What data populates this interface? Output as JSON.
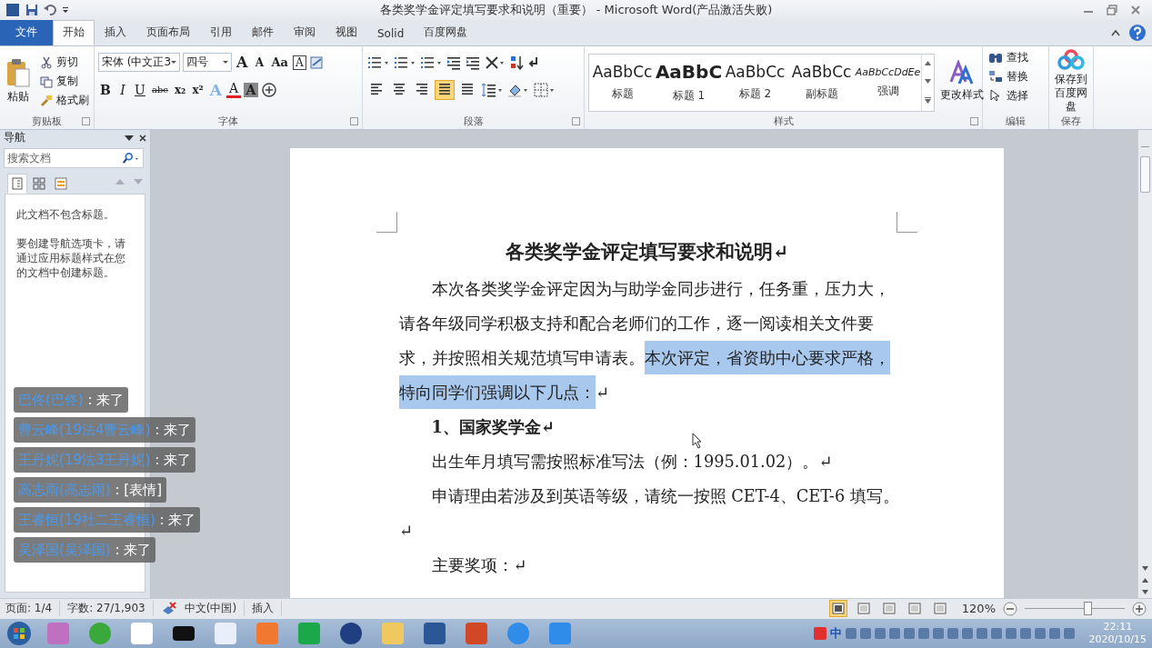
{
  "window": {
    "title": "各类奖学金评定填写要求和说明（重要） - Microsoft Word(产品激活失败)"
  },
  "ribbon_tabs": [
    {
      "label": "文件",
      "kind": "file",
      "selected": false
    },
    {
      "label": "开始",
      "kind": "tab",
      "selected": true
    },
    {
      "label": "插入",
      "kind": "tab",
      "selected": false
    },
    {
      "label": "页面布局",
      "kind": "tab",
      "selected": false
    },
    {
      "label": "引用",
      "kind": "tab",
      "selected": false
    },
    {
      "label": "邮件",
      "kind": "tab",
      "selected": false
    },
    {
      "label": "审阅",
      "kind": "tab",
      "selected": false
    },
    {
      "label": "视图",
      "kind": "tab",
      "selected": false
    },
    {
      "label": "Solid",
      "kind": "tab",
      "selected": false
    },
    {
      "label": "百度网盘",
      "kind": "tab",
      "selected": false
    }
  ],
  "clipboard": {
    "paste": "粘贴",
    "items": [
      {
        "label": "剪切",
        "kind": "cut"
      },
      {
        "label": "复制",
        "kind": "copy"
      },
      {
        "label": "格式刷",
        "kind": "brush"
      }
    ],
    "group": "剪贴板"
  },
  "font": {
    "name": "宋体 (中文正3",
    "size": "四号",
    "group": "字体",
    "row1": [
      {
        "label": "A",
        "kind": "grow"
      },
      {
        "label": "A",
        "kind": "shrink"
      },
      {
        "label": "Aa",
        "kind": "case"
      },
      {
        "label": "A",
        "kind": "border"
      }
    ],
    "row2": [
      {
        "label": "B",
        "kind": "bold"
      },
      {
        "label": "I",
        "kind": "italic"
      },
      {
        "label": "U",
        "kind": "underline"
      },
      {
        "label": "abc",
        "kind": "strike"
      },
      {
        "label": "x₂",
        "kind": "sub"
      },
      {
        "label": "x²",
        "kind": "sup"
      },
      {
        "label": "A",
        "kind": "effect"
      },
      {
        "label": "A",
        "kind": "color"
      },
      {
        "label": "A",
        "kind": "shade"
      }
    ]
  },
  "paragraph": {
    "group": "段落",
    "alignment": [
      {
        "kind": "left",
        "selected": false
      },
      {
        "kind": "center",
        "selected": false
      },
      {
        "kind": "right",
        "selected": false
      },
      {
        "kind": "justify",
        "selected": true
      },
      {
        "kind": "distributed",
        "selected": false
      }
    ]
  },
  "styles": {
    "group": "样式",
    "items": [
      {
        "preview": "AaBbCc",
        "label": "标题",
        "kind": "normal"
      },
      {
        "preview": "AaBbC",
        "label": "标题 1",
        "kind": "bold"
      },
      {
        "preview": "AaBbCc",
        "label": "标题 2",
        "kind": "normal"
      },
      {
        "preview": "AaBbCc",
        "label": "副标题",
        "kind": "normal"
      },
      {
        "preview": "AaBbCcDdEe",
        "label": "强调",
        "kind": "italic"
      }
    ],
    "change": "更改样式"
  },
  "editing": {
    "group": "编辑",
    "items": [
      {
        "label": "查找",
        "kind": "find"
      },
      {
        "label": "替换",
        "kind": "replace"
      },
      {
        "label": "选择",
        "kind": "select"
      }
    ]
  },
  "save": {
    "label": "保存到百度网盘",
    "group": "保存"
  },
  "navigation": {
    "title": "导航",
    "search_placeholder": "搜索文档",
    "tabs": [
      {
        "kind": "headings",
        "selected": true
      },
      {
        "kind": "pages",
        "selected": false
      },
      {
        "kind": "results",
        "selected": false
      }
    ],
    "messages": [
      "此文档不包含标题。",
      "要创建导航选项卡，请通过应用标题样式在您的文档中创建标题。"
    ]
  },
  "chat": [
    {
      "name": "巴佟(巴佟)",
      "message": ": 来了"
    },
    {
      "name": "曹云峰(19法4曹云峰)",
      "message": ": 来了"
    },
    {
      "name": "王丹妮(19法3王丹妮)",
      "message": ": 来了"
    },
    {
      "name": "高志雨(高志雨)",
      "message": ": [表情]"
    },
    {
      "name": "王睿恒(19社二王睿恒)",
      "message": ": 来了"
    },
    {
      "name": "吴泽国(吴泽国)",
      "message": ": 来了"
    }
  ],
  "document": {
    "title": "各类奖学金评定填写要求和说明↵",
    "paragraphs": [
      {
        "kind": "body",
        "indent": true,
        "parts": [
          {
            "text": "本次各类奖学金评定因为与助学金同步进行，任务重，压力大，请各年级同学积极支持和配合老师们的工作，逐一阅读相关文件要求，并按照相关规范填写申请表。",
            "highlighted": false
          },
          {
            "text": "本次评定，省资助中心要求严格，特向同学们强调以下几点：",
            "highlighted": true
          },
          {
            "text": "↵",
            "highlighted": false
          }
        ]
      },
      {
        "kind": "heading",
        "indent": true,
        "parts": [
          {
            "text": "1、国家奖学金↵",
            "highlighted": false
          }
        ]
      },
      {
        "kind": "body",
        "indent": true,
        "parts": [
          {
            "text": "出生年月填写需按照标准写法（例：1995.01.02）。↵",
            "highlighted": false
          }
        ]
      },
      {
        "kind": "body",
        "indent": true,
        "parts": [
          {
            "text": "申请理由若涉及到英语等级，请统一按照 CET-4、CET-6 填写。↵",
            "highlighted": false
          }
        ]
      },
      {
        "kind": "body",
        "indent": true,
        "parts": [
          {
            "text": "主要奖项：↵",
            "highlighted": false
          }
        ]
      }
    ]
  },
  "status_bar": {
    "items": [
      "页面: 1/4",
      "字数: 27/1,903"
    ],
    "language": "中文(中国)",
    "mode": "插入",
    "views": [
      {
        "kind": "print",
        "selected": true
      },
      {
        "kind": "read",
        "selected": false
      },
      {
        "kind": "web",
        "selected": false
      },
      {
        "kind": "outline",
        "selected": false
      },
      {
        "kind": "draft",
        "selected": false
      }
    ],
    "zoom": "120%",
    "zoom_level": {
      "level": 0.62
    }
  },
  "taskbar": {
    "ime": "中",
    "time": "22:11",
    "date": "2020/10/15"
  }
}
